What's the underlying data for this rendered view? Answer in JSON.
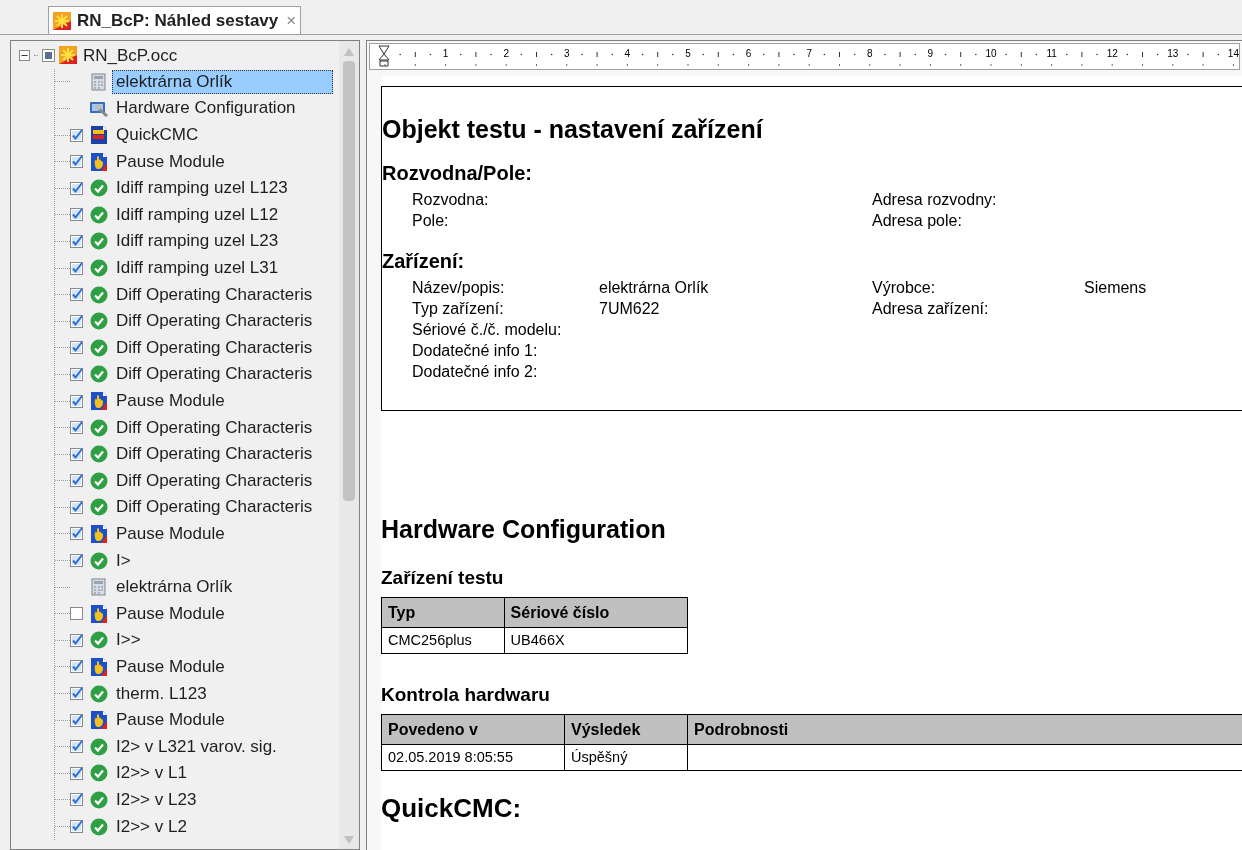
{
  "tab": {
    "title": "RN_BcP: Náhled sestavy",
    "close": "×",
    "selected": true
  },
  "tree": {
    "root": {
      "label": "RN_BcP.occ",
      "expanded": true,
      "checked": false,
      "indeterminate": true
    },
    "items": [
      {
        "label": "elektrárna Orlík",
        "kind": "device",
        "selected": true
      },
      {
        "label": "Hardware Configuration",
        "kind": "hardware",
        "selected": false
      },
      {
        "label": "QuickCMC",
        "kind": "quickcmc",
        "checked": true,
        "selected": false
      },
      {
        "label": "Pause Module",
        "kind": "pause",
        "checked": true,
        "selected": false
      },
      {
        "label": "Idiff ramping uzel L123",
        "kind": "passed",
        "checked": true,
        "selected": false
      },
      {
        "label": "Idiff ramping uzel L12",
        "kind": "passed",
        "checked": true,
        "selected": false
      },
      {
        "label": "Idiff ramping uzel L23",
        "kind": "passed",
        "checked": true,
        "selected": false
      },
      {
        "label": "Idiff ramping uzel L31",
        "kind": "passed",
        "checked": true,
        "selected": false
      },
      {
        "label": "Diff Operating Characteris",
        "kind": "passed",
        "checked": true,
        "selected": false
      },
      {
        "label": "Diff Operating Characteris",
        "kind": "passed",
        "checked": true,
        "selected": false
      },
      {
        "label": "Diff Operating Characteris",
        "kind": "passed",
        "checked": true,
        "selected": false
      },
      {
        "label": "Diff Operating Characteris",
        "kind": "passed",
        "checked": true,
        "selected": false
      },
      {
        "label": "Pause Module",
        "kind": "pause",
        "checked": true,
        "selected": false
      },
      {
        "label": "Diff Operating Characteris",
        "kind": "passed",
        "checked": true,
        "selected": false
      },
      {
        "label": "Diff Operating Characteris",
        "kind": "passed",
        "checked": true,
        "selected": false
      },
      {
        "label": "Diff Operating Characteris",
        "kind": "passed",
        "checked": true,
        "selected": false
      },
      {
        "label": "Diff Operating Characteris",
        "kind": "passed",
        "checked": true,
        "selected": false
      },
      {
        "label": "Pause Module",
        "kind": "pause",
        "checked": true,
        "selected": false
      },
      {
        "label": "I>",
        "kind": "passed",
        "checked": true,
        "selected": false
      },
      {
        "label": "elektrárna Orlík",
        "kind": "device",
        "selected": false
      },
      {
        "label": "Pause Module",
        "kind": "pause",
        "checked": false,
        "selected": false
      },
      {
        "label": "I>>",
        "kind": "passed",
        "checked": true,
        "selected": false
      },
      {
        "label": "Pause Module",
        "kind": "pause",
        "checked": true,
        "selected": false
      },
      {
        "label": "therm. L123",
        "kind": "passed",
        "checked": true,
        "selected": false
      },
      {
        "label": "Pause Module",
        "kind": "pause",
        "checked": true,
        "selected": false
      },
      {
        "label": "I2> v L321 varov. sig.",
        "kind": "passed",
        "checked": true,
        "selected": false
      },
      {
        "label": "I2>> v L1",
        "kind": "passed",
        "checked": true,
        "selected": false
      },
      {
        "label": "I2>> v L23",
        "kind": "passed",
        "checked": true,
        "selected": false
      },
      {
        "label": "I2>> v L2",
        "kind": "passed",
        "checked": true,
        "selected": false
      }
    ]
  },
  "ruler": {
    "labels": [
      "1",
      "2",
      "3",
      "4",
      "5",
      "6",
      "7",
      "8",
      "9",
      "10",
      "11",
      "12",
      "13",
      "14"
    ]
  },
  "report": {
    "object_title": "Objekt testu - nastavení zařízení",
    "object_sections": [
      {
        "title": "Rozvodna/Pole:",
        "rows": [
          {
            "left": {
              "label": "Rozvodna:"
            },
            "right": {
              "label": "Adresa rozvodny:"
            }
          },
          {
            "left": {
              "label": "Pole:"
            },
            "right": {
              "label": "Adresa pole:"
            }
          }
        ]
      },
      {
        "title": "Zařízení:",
        "rows": [
          {
            "left": {
              "label": "Název/popis:",
              "value": "elektrárna Orlík"
            },
            "right": {
              "label": "Výrobce:",
              "value": "Siemens"
            }
          },
          {
            "left": {
              "label": "Typ zařízení:",
              "value": "7UM622"
            },
            "right": {
              "label": "Adresa zařízení:"
            }
          },
          {
            "left": {
              "label": "Sériové č./č. modelu:"
            }
          },
          {
            "left": {
              "label": "Dodatečné info 1:"
            }
          },
          {
            "left": {
              "label": "Dodatečné info 2:"
            }
          }
        ]
      }
    ],
    "hw_title": "Hardware Configuration",
    "tables": [
      {
        "title": "Zařízení testu",
        "columns": [
          "Typ",
          "Sériové číslo"
        ],
        "rows": [
          [
            "CMC256plus",
            "UB466X"
          ]
        ]
      },
      {
        "title": "Kontrola hardwaru",
        "columns": [
          "Povedeno v",
          "Výsledek",
          "Podrobnosti"
        ],
        "rows": [
          [
            "02.05.2019 8:05:55",
            "Úspěšný"
          ]
        ]
      }
    ],
    "next_title": "QuickCMC:"
  }
}
